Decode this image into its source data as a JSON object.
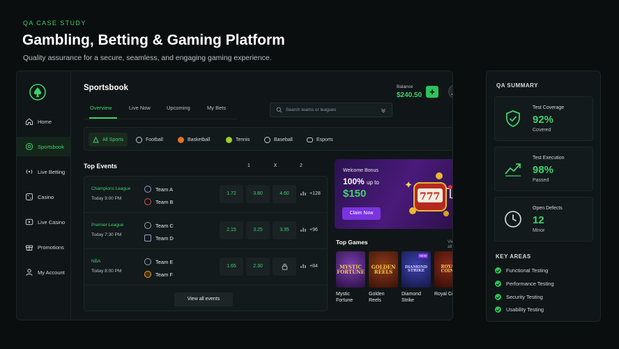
{
  "header": {
    "kicker": "QA CASE STUDY",
    "title": "Gambling, Betting & Gaming Platform",
    "subtitle": "Quality assurance for a secure, seamless, and engaging gaming experience."
  },
  "sidebar": {
    "items": [
      {
        "label": "Home",
        "icon": "home-icon"
      },
      {
        "label": "Sportsbook",
        "icon": "soccer-ball-icon",
        "active": true
      },
      {
        "label": "Live Betting",
        "icon": "broadcast-icon"
      },
      {
        "label": "Casino",
        "icon": "dice-icon"
      },
      {
        "label": "Live Casino",
        "icon": "video-icon"
      },
      {
        "label": "Promotions",
        "icon": "gift-icon"
      },
      {
        "label": "My Account",
        "icon": "user-icon"
      }
    ]
  },
  "main": {
    "title": "Sportsbook",
    "balance_label": "Balance",
    "balance_value": "$240.50",
    "add_label": "+",
    "tabs": [
      {
        "label": "Overview",
        "active": true
      },
      {
        "label": "Live Now"
      },
      {
        "label": "Upcoming"
      },
      {
        "label": "My Bets"
      }
    ],
    "search_placeholder": "Search teams or leagues",
    "filters": [
      {
        "label": "All Sports",
        "active": true
      },
      {
        "label": "Football"
      },
      {
        "label": "Basketball"
      },
      {
        "label": "Tennis"
      },
      {
        "label": "Baseball"
      },
      {
        "label": "Esports"
      }
    ],
    "events_title": "Top Events",
    "col_headers": [
      "1",
      "X",
      "2"
    ],
    "events": [
      {
        "league": "Champions League",
        "time": "Today 9:00 PM",
        "team_a": "Team A",
        "team_b": "Team B",
        "odds": [
          "1.72",
          "3.80",
          "4.60"
        ],
        "more": "+128"
      },
      {
        "league": "Premier League",
        "time": "Today 7:30 PM",
        "team_a": "Team C",
        "team_b": "Team D",
        "odds": [
          "2.15",
          "3.25",
          "3.35"
        ],
        "more": "+96"
      },
      {
        "league": "NBA",
        "time": "Today 8:00 PM",
        "team_a": "Team E",
        "team_b": "Team F",
        "odds": [
          "1.65",
          "2.30",
          ""
        ],
        "more": "+84"
      }
    ],
    "view_all_events": "View all events",
    "bonus": {
      "small": "Welcome Bonus",
      "big": "100%",
      "big_suffix": "up to",
      "amount": "$150",
      "cta": "Claim Now"
    },
    "games_title": "Top Games",
    "games_view_all": "View all",
    "games": [
      {
        "name": "Mystic Fortune",
        "art": "MYSTIC FORTUNE"
      },
      {
        "name": "Golden Reels",
        "art": "GOLDEN REELS"
      },
      {
        "name": "Diamond Strike",
        "art": "DIAMOND STRIKE",
        "badge": "NEW"
      },
      {
        "name": "Royal Coins",
        "art": "ROYAL COINS"
      }
    ]
  },
  "qa": {
    "title": "QA SUMMARY",
    "metrics": [
      {
        "label": "Test Coverage",
        "value": "92%",
        "sub": "Covered",
        "icon": "shield-check-icon"
      },
      {
        "label": "Test Execution",
        "value": "98%",
        "sub": "Passed",
        "icon": "trend-up-icon"
      },
      {
        "label": "Open Defects",
        "value": "12",
        "sub": "Minor",
        "icon": "clock-icon"
      }
    ],
    "key_areas_title": "KEY AREAS",
    "key_areas": [
      "Functional Testing",
      "Performance Testing",
      "Security Testing",
      "Usability Testing"
    ]
  },
  "colors": {
    "accent": "#3fd16a",
    "background": "#0a0e0f",
    "panel": "#101617",
    "bonus_purple": "#7a34e0"
  }
}
